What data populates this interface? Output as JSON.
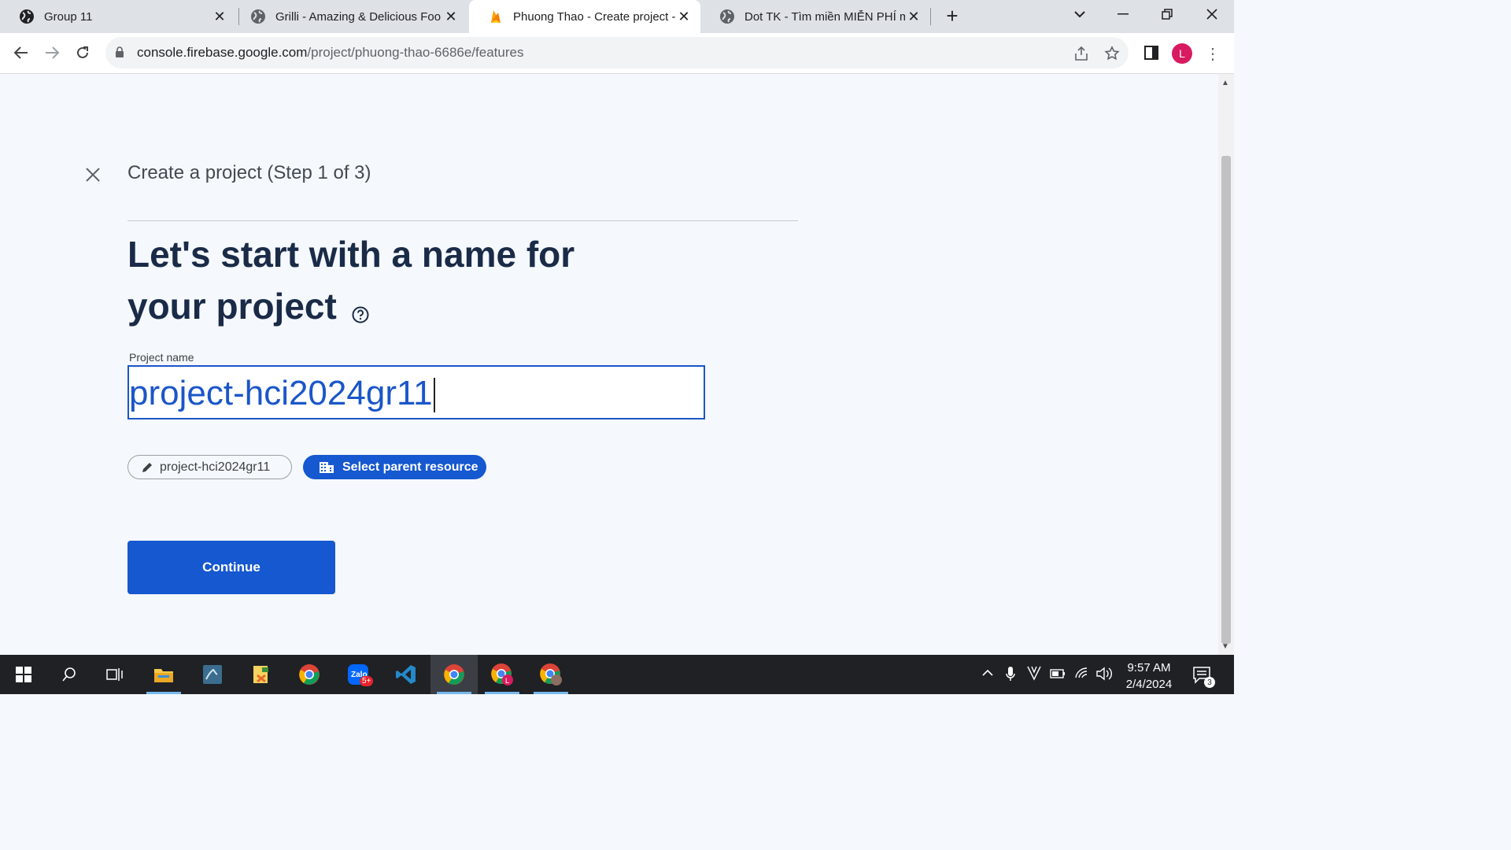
{
  "browser": {
    "tabs": [
      {
        "title": "Group 11",
        "favicon": "globe-icon",
        "active": false
      },
      {
        "title": "Grilli - Amazing & Delicious Foo",
        "favicon": "globe-icon",
        "active": false
      },
      {
        "title": "Phuong Thao - Create project - F",
        "favicon": "firebase-icon",
        "active": true
      },
      {
        "title": "Dot TK - Tìm miền MIỄN PHÍ mớ",
        "favicon": "globe-icon",
        "active": false
      }
    ],
    "url_domain": "console.firebase.google.com",
    "url_path": "/project/phuong-thao-6686e/features",
    "profile_initial": "L"
  },
  "page": {
    "step_title": "Create a project (Step 1 of 3)",
    "heading": "Let's start with a name for your project",
    "project_name_label": "Project name",
    "project_name_value": "project-hci2024gr11",
    "project_id_chip": "project-hci2024gr11",
    "parent_resource_button": "Select parent resource",
    "continue_button": "Continue"
  },
  "taskbar": {
    "apps": [
      "windows-start-icon",
      "search-icon",
      "task-view-icon",
      "file-explorer-icon",
      "mysql-workbench-icon",
      "notepad-app-icon",
      "chrome-icon",
      "zalo-icon",
      "vscode-icon",
      "chrome-active-icon",
      "chrome-profile-l-icon",
      "chrome-profile-2-icon"
    ],
    "zalo_badge": "5+",
    "time": "9:57 AM",
    "date": "2/4/2024",
    "notification_count": "3"
  },
  "colors": {
    "primary_blue": "#1558d0",
    "heading_navy": "#1a2b48",
    "page_bg": "#f5f8fc",
    "profile_pink": "#d81b60"
  }
}
